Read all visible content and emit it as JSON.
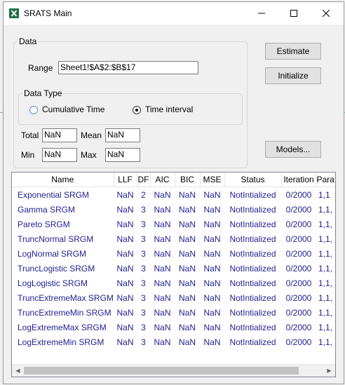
{
  "window": {
    "title": "SRATS Main"
  },
  "data_group": {
    "legend": "Data",
    "range_label": "Range",
    "range_value": "Sheet1!$A$2:$B$17",
    "data_type": {
      "legend": "Data Type",
      "option_cumulative": "Cumulative Time",
      "option_interval": "Time interval",
      "selected": "Time interval"
    },
    "stats": {
      "total_label": "Total",
      "total_value": "NaN",
      "mean_label": "Mean",
      "mean_value": "NaN",
      "min_label": "Min",
      "min_value": "NaN",
      "max_label": "Max",
      "max_value": "NaN"
    }
  },
  "buttons": {
    "estimate": "Estimate",
    "initialize": "Initialize",
    "models": "Models..."
  },
  "table": {
    "columns": [
      "Name",
      "LLF",
      "DF",
      "AIC",
      "BIC",
      "MSE",
      "Status",
      "Iteration",
      "Para"
    ],
    "rows": [
      [
        "Exponential SRGM",
        "NaN",
        "2",
        "NaN",
        "NaN",
        "NaN",
        "NotIntialized",
        "0/2000",
        "1,1"
      ],
      [
        "Gamma SRGM",
        "NaN",
        "3",
        "NaN",
        "NaN",
        "NaN",
        "NotIntialized",
        "0/2000",
        "1,1,"
      ],
      [
        "Pareto SRGM",
        "NaN",
        "3",
        "NaN",
        "NaN",
        "NaN",
        "NotIntialized",
        "0/2000",
        "1,1,"
      ],
      [
        "TruncNormal SRGM",
        "NaN",
        "3",
        "NaN",
        "NaN",
        "NaN",
        "NotIntialized",
        "0/2000",
        "1,1,"
      ],
      [
        "LogNormal SRGM",
        "NaN",
        "3",
        "NaN",
        "NaN",
        "NaN",
        "NotIntialized",
        "0/2000",
        "1,1,"
      ],
      [
        "TruncLogistic SRGM",
        "NaN",
        "3",
        "NaN",
        "NaN",
        "NaN",
        "NotIntialized",
        "0/2000",
        "1,1,"
      ],
      [
        "LogLogistic SRGM",
        "NaN",
        "3",
        "NaN",
        "NaN",
        "NaN",
        "NotIntialized",
        "0/2000",
        "1,1,"
      ],
      [
        "TruncExtremeMax SRGM",
        "NaN",
        "3",
        "NaN",
        "NaN",
        "NaN",
        "NotIntialized",
        "0/2000",
        "1,1,"
      ],
      [
        "TruncExtremeMin SRGM",
        "NaN",
        "3",
        "NaN",
        "NaN",
        "NaN",
        "NotIntialized",
        "0/2000",
        "1,1,"
      ],
      [
        "LogExtremeMax SRGM",
        "NaN",
        "3",
        "NaN",
        "NaN",
        "NaN",
        "NotIntialized",
        "0/2000",
        "1,1,"
      ],
      [
        "LogExtremeMin SRGM",
        "NaN",
        "3",
        "NaN",
        "NaN",
        "NaN",
        "NotIntialized",
        "0/2000",
        "1,1,"
      ]
    ]
  },
  "icons": {
    "app": "excel-icon",
    "minimize": "minimize-icon",
    "maximize": "maximize-icon",
    "close": "close-icon",
    "scroll_left": "scroll-left-arrow-icon",
    "scroll_right": "scroll-right-arrow-icon"
  },
  "colors": {
    "cell_text": "#1f1f8f",
    "excel_green": "#1d6f42",
    "radio_blue": "#0063b1"
  }
}
